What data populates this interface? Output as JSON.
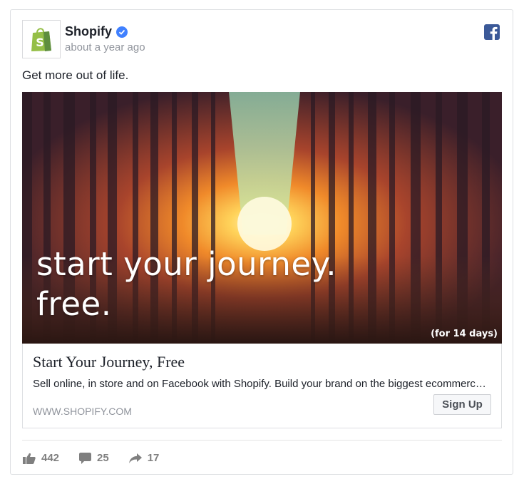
{
  "post": {
    "author": "Shopify",
    "time": "about a year ago",
    "text": "Get more out of life."
  },
  "hero": {
    "line1": "start your journey.",
    "line2": "free.",
    "note": "(for 14 days)"
  },
  "link": {
    "title": "Start Your Journey, Free",
    "description": "Sell online, in store and on Facebook with Shopify. Build your brand on the biggest ecommerce platform.",
    "domain": "WWW.SHOPIFY.COM",
    "cta": "Sign Up"
  },
  "stats": {
    "likes": "442",
    "comments": "25",
    "shares": "17"
  },
  "colors": {
    "shopify_green": "#95bf47",
    "facebook_blue": "#3b5998",
    "verified_blue": "#4080ff"
  }
}
